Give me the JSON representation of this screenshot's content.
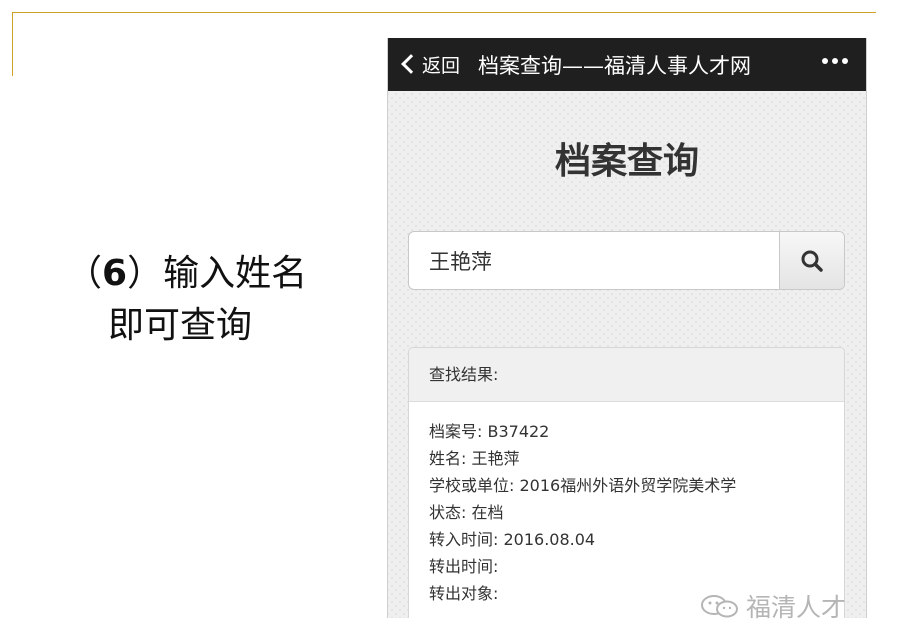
{
  "caption": {
    "num": "6",
    "line1_text": "输入姓名",
    "line2": "即可查询"
  },
  "navbar": {
    "back_label": "返回",
    "title": "档案查询——福清人事人才网"
  },
  "page": {
    "heading": "档案查询"
  },
  "search": {
    "value": "王艳萍"
  },
  "result": {
    "header": "查找结果:",
    "rows": [
      "档案号: B37422",
      "姓名: 王艳萍",
      "学校或单位: 2016福州外语外贸学院美术学",
      "状态: 在档",
      "转入时间: 2016.08.04",
      "转出时间:",
      "转出对象:"
    ]
  },
  "watermark": {
    "text": "福清人才"
  },
  "icons": {
    "back": "chevron-left-icon",
    "more": "more-dots-icon",
    "search": "search-icon",
    "watermark": "wechat-icon"
  },
  "colors": {
    "accent_rule": "#c9a227",
    "navbar": "#1f1f1f"
  }
}
